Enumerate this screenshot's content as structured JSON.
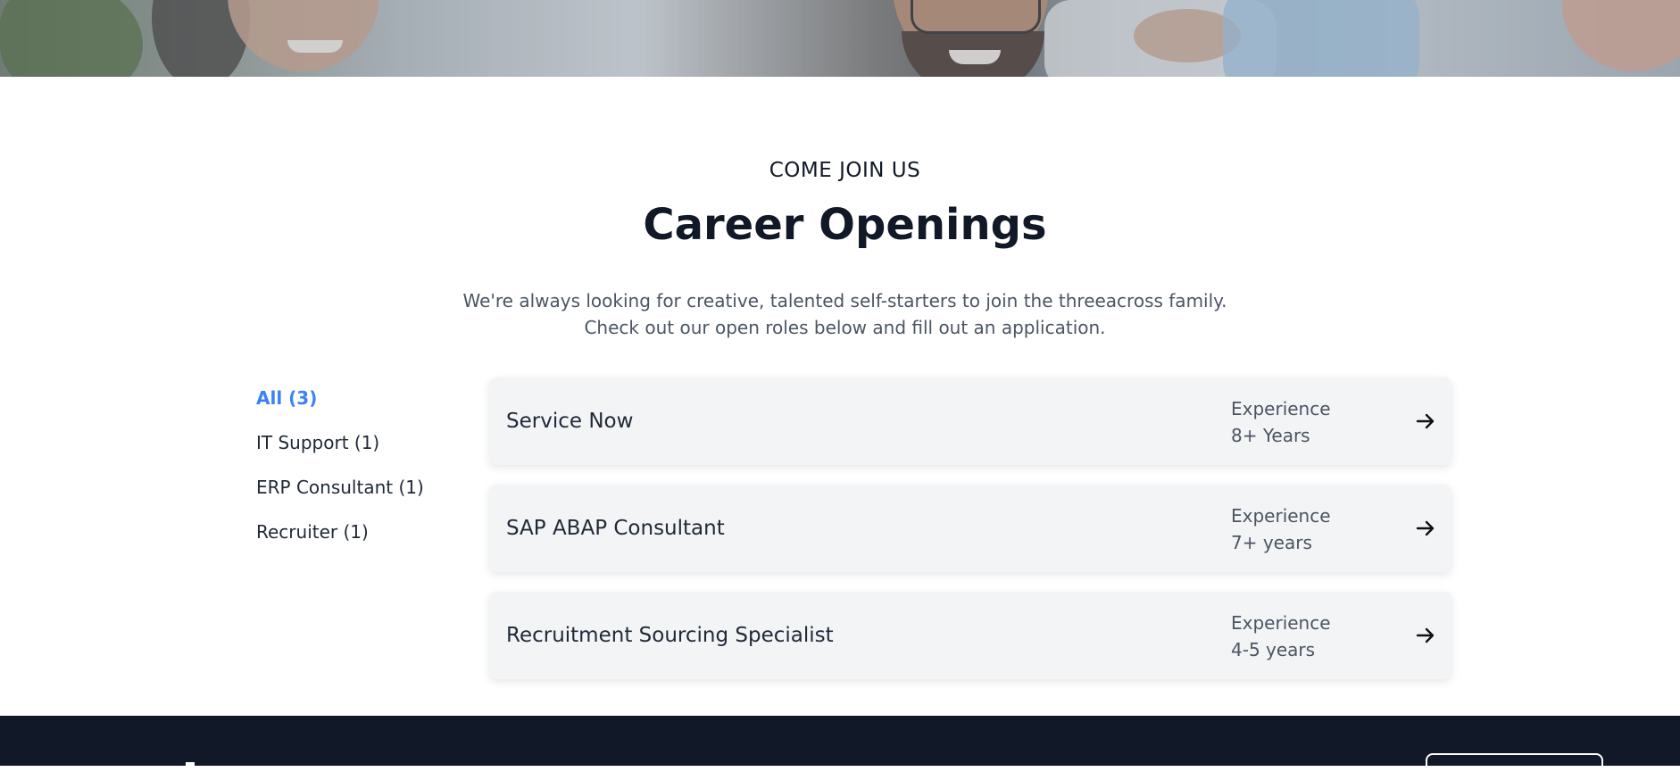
{
  "section": {
    "eyebrow": "COME JOIN US",
    "title": "Career Openings",
    "intro_line1": "We're always looking for creative, talented self-starters to join the threeacross family.",
    "intro_line2": "Check out our open roles below and fill out an application."
  },
  "filters": [
    {
      "label": "All (3)",
      "active": true
    },
    {
      "label": "IT Support (1)",
      "active": false
    },
    {
      "label": "ERP Consultant (1)",
      "active": false
    },
    {
      "label": "Recruiter (1)",
      "active": false
    }
  ],
  "jobs": [
    {
      "title": "Service Now",
      "experience_label": "Experience",
      "experience_value": "8+ Years",
      "icon": "arrow-right-icon"
    },
    {
      "title": "SAP ABAP Consultant",
      "experience_label": "Experience",
      "experience_value": "7+ years",
      "icon": "arrow-right-icon"
    },
    {
      "title": "Recruitment Sourcing Specialist",
      "experience_label": "Experience",
      "experience_value": "4-5 years",
      "icon": "arrow-right-icon"
    }
  ],
  "colors": {
    "accent": "#3b82f6",
    "heading": "#111827",
    "muted": "#4b5563",
    "card_bg": "#f3f4f6",
    "footer_bg": "#111827"
  }
}
